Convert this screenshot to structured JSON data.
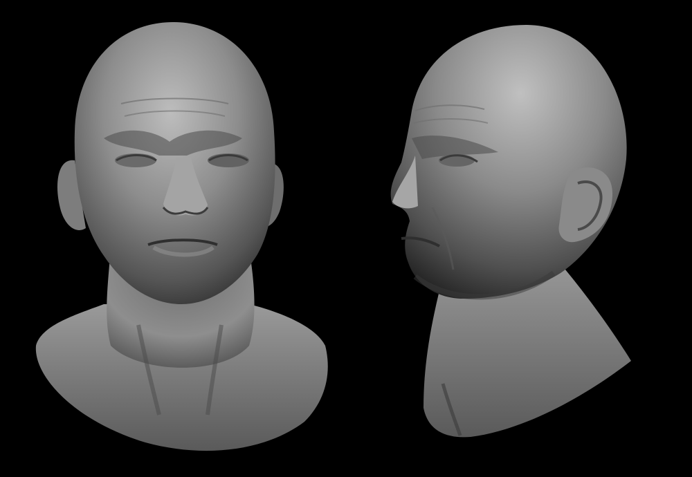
{
  "colors": {
    "background": "#000000",
    "clay_light": "#b9b9b9",
    "clay_mid": "#7c7c7c",
    "clay_dark": "#2e2e2e"
  },
  "views": [
    {
      "view": "front"
    },
    {
      "view": "three-quarter"
    }
  ]
}
